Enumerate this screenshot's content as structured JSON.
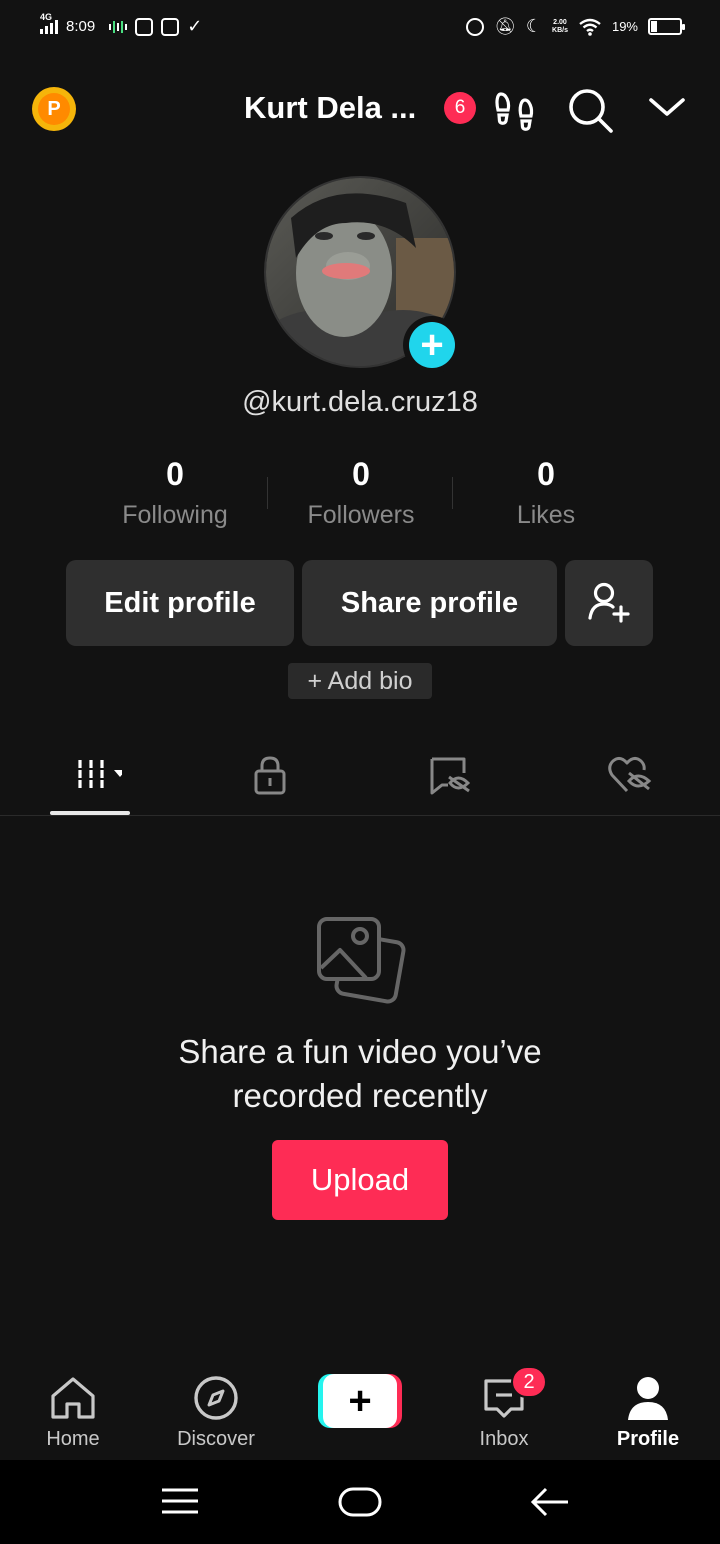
{
  "status_bar": {
    "network": "4G",
    "time": "8:09",
    "speed_value": "2.00",
    "speed_unit": "KB/s",
    "battery": "19%"
  },
  "header": {
    "title": "Kurt Dela ...",
    "notification_count": "6",
    "coin_letter": "P",
    "icons": [
      "coin-icon",
      "footprints-icon",
      "search-icon",
      "chevron-down-icon"
    ]
  },
  "profile": {
    "username": "@kurt.dela.cruz18",
    "stats": [
      {
        "value": "0",
        "label": "Following"
      },
      {
        "value": "0",
        "label": "Followers"
      },
      {
        "value": "0",
        "label": "Likes"
      }
    ],
    "edit_label": "Edit profile",
    "share_label": "Share profile",
    "bio_label": "+ Add bio"
  },
  "tabs": [
    "videos-grid-icon",
    "lock-icon",
    "repost-hidden-icon",
    "liked-hidden-icon"
  ],
  "empty_state": {
    "line1": "Share a fun video you’ve",
    "line2": "recorded recently",
    "upload_label": "Upload"
  },
  "bottom_nav": {
    "home": "Home",
    "discover": "Discover",
    "create": "+",
    "inbox": "Inbox",
    "inbox_badge": "2",
    "profile": "Profile"
  },
  "colors": {
    "background": "#121212",
    "accent": "#fe2c55",
    "cyan": "#25f4ee",
    "coin": "#f5b50a"
  }
}
